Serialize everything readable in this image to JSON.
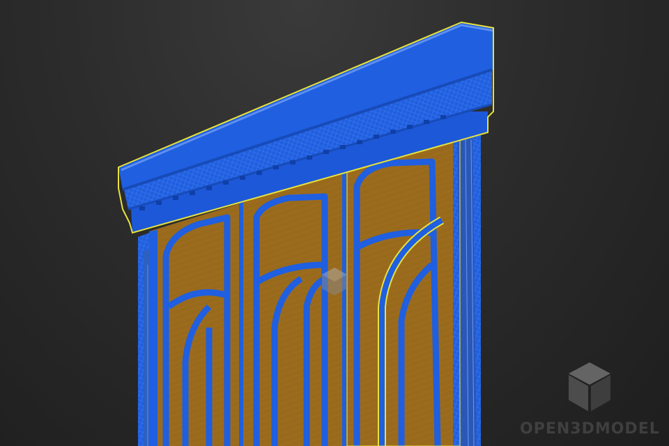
{
  "watermark": {
    "label": "OPEN3DMODEL",
    "icon": "cube-icon"
  },
  "colors": {
    "wood": "#9a6a1c",
    "wire": "#1f5fe0",
    "selection": "#e8e23a",
    "background": "#2a2a2a"
  }
}
